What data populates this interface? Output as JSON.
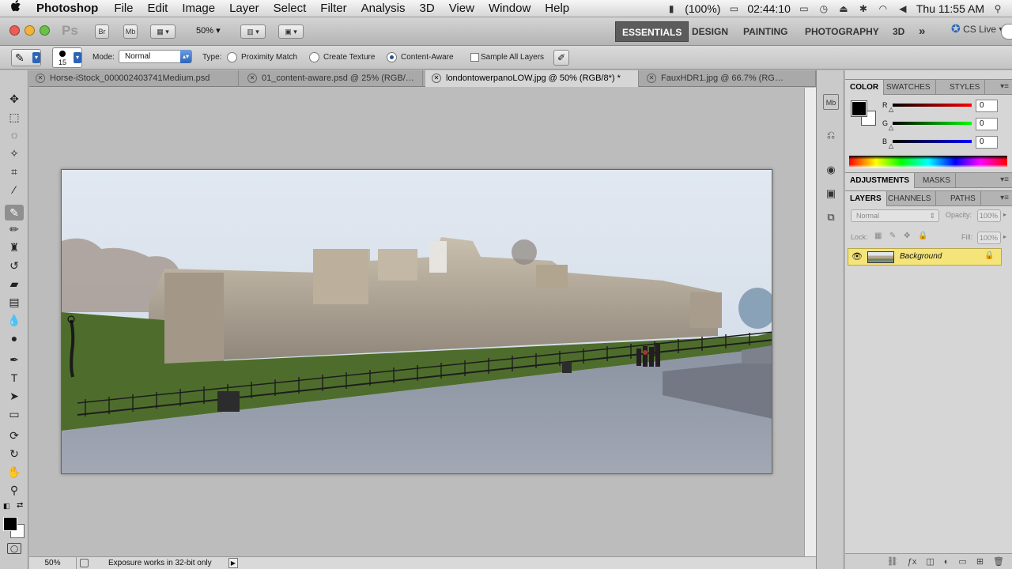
{
  "menubar": {
    "app_name": "Photoshop",
    "menus": [
      "File",
      "Edit",
      "Image",
      "Layer",
      "Select",
      "Filter",
      "Analysis",
      "3D",
      "View",
      "Window",
      "Help"
    ],
    "battery": "(100%)",
    "timer": "02:44:10",
    "clock": "Thu 11:55 AM"
  },
  "appbar": {
    "logo": "Ps",
    "bridge_label": "Br",
    "minibridge_label": "Mb",
    "zoom": "50%",
    "workspaces": [
      "ESSENTIALS",
      "DESIGN",
      "PAINTING",
      "PHOTOGRAPHY",
      "3D"
    ],
    "more": "»",
    "cs_live": "CS Live"
  },
  "options": {
    "brush_size": "15",
    "mode_label": "Mode:",
    "mode_value": "Normal",
    "type_label": "Type:",
    "proximity_match": "Proximity Match",
    "create_texture": "Create Texture",
    "content_aware": "Content-Aware",
    "sample_all_layers": "Sample All Layers",
    "selected_type": "Content-Aware"
  },
  "tabs": [
    {
      "label": "Horse-iStock_000002403741Medium.psd",
      "active": false
    },
    {
      "label": "01_content-aware.psd @ 25% (RGB/…",
      "active": false
    },
    {
      "label": "londontowerpanoLOW.jpg @ 50% (RGB/8*) *",
      "active": true
    },
    {
      "label": "FauxHDR1.jpg @ 66.7% (RG…",
      "active": false
    }
  ],
  "status": {
    "zoom": "50%",
    "info": "Exposure works in 32-bit only",
    "arrow": "▶"
  },
  "color_panel": {
    "tabs": [
      "COLOR",
      "SWATCHES",
      "STYLES"
    ],
    "channels": [
      {
        "label": "R",
        "value": "0"
      },
      {
        "label": "G",
        "value": "0"
      },
      {
        "label": "B",
        "value": "0"
      }
    ]
  },
  "adjust_panel": {
    "tabs": [
      "ADJUSTMENTS",
      "MASKS"
    ]
  },
  "layers_panel": {
    "tabs": [
      "LAYERS",
      "CHANNELS",
      "PATHS"
    ],
    "blend_mode": "Normal",
    "opacity_label": "Opacity:",
    "opacity_value": "100%",
    "lock_label": "Lock:",
    "fill_label": "Fill:",
    "fill_value": "100%",
    "layers": [
      {
        "name": "Background",
        "visible": true,
        "locked": true
      }
    ]
  },
  "colors": {
    "accent_selection": "#f5e47a",
    "radio_selected": "#2a4f8f"
  }
}
